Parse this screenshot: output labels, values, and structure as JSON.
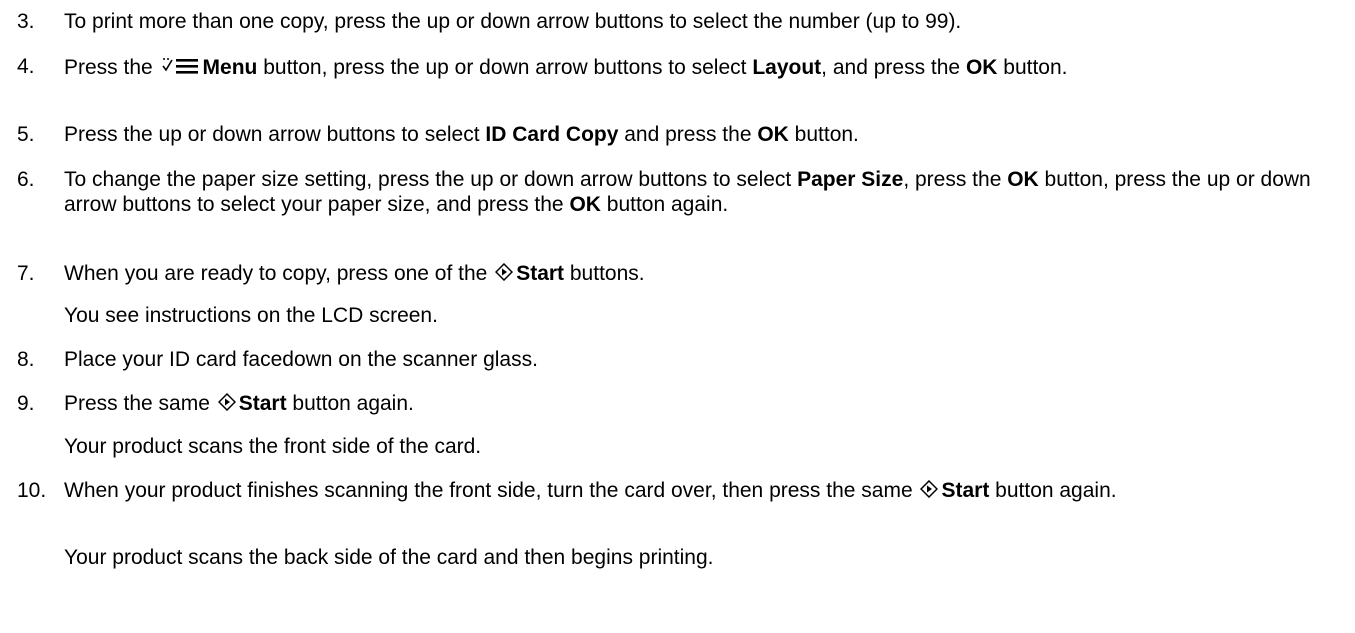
{
  "steps": [
    {
      "num": "3.",
      "parts": [
        "To print more than one copy, press the up or down arrow buttons to select the number (up to 99)."
      ]
    },
    {
      "num": "4.",
      "parts": [
        "Press the ",
        "Menu",
        " button, press the up or down arrow buttons to select ",
        "Layout",
        ", and press the ",
        "OK",
        " button."
      ]
    },
    {
      "num": "5.",
      "parts": [
        "Press the up or down arrow buttons to select ",
        "ID Card Copy",
        " and press the ",
        "OK",
        " button."
      ]
    },
    {
      "num": "6.",
      "parts": [
        "To change the paper size setting, press the up or down arrow buttons to select ",
        "Paper Size",
        ", press the ",
        "OK",
        " button, press the up or down arrow buttons to select your paper size, and press the ",
        "OK",
        " button again."
      ]
    },
    {
      "num": "7.",
      "parts": [
        "When you are ready to copy, press one of the ",
        "Start",
        " buttons."
      ],
      "note": "You see instructions on the LCD screen."
    },
    {
      "num": "8.",
      "parts": [
        "Place your ID card facedown on the scanner glass."
      ]
    },
    {
      "num": "9.",
      "parts": [
        "Press the same ",
        "Start",
        " button again."
      ],
      "note": "Your product scans the front side of the card."
    },
    {
      "num": "10.",
      "parts": [
        "When your product finishes scanning the front side, turn the card over, then press the same ",
        "Start",
        " button again."
      ],
      "note": "Your product scans the back side of the card and then begins printing."
    }
  ],
  "icons": {
    "menu": "menu-icon",
    "start": "start-icon"
  }
}
